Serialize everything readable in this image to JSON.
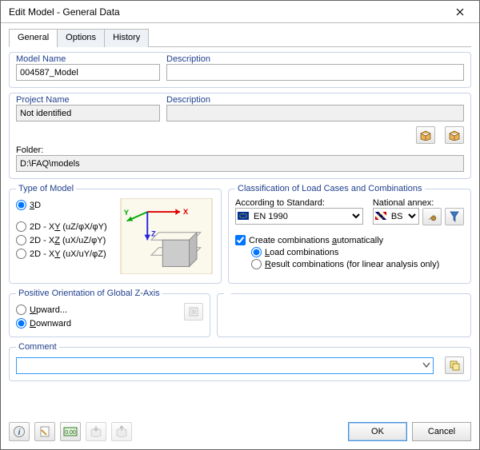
{
  "window": {
    "title": "Edit Model - General Data",
    "ok": "OK",
    "cancel": "Cancel"
  },
  "tabs": {
    "general": "General",
    "options": "Options",
    "history": "History"
  },
  "model": {
    "name_label": "Model Name",
    "name_value": "004587_Model",
    "desc_label": "Description",
    "desc_value": ""
  },
  "project": {
    "name_label": "Project Name",
    "name_value": "Not identified",
    "desc_label": "Description",
    "desc_value": "",
    "folder_label": "Folder:",
    "folder_value": "D:\\FAQ\\models"
  },
  "type": {
    "legend": "Type of Model",
    "opt3d_a": "3",
    "opt3d_b": "D",
    "xy_a": "2D - X",
    "xy_u": "Y",
    "xy_b": " (u",
    "xy_u2": "Z",
    "xy_c": "/φ",
    "xy_u3": "X",
    "xy_d": "/φ",
    "xy_u4": "Y",
    "xy_e": ")",
    "xz_a": "2D - X",
    "xz_u": "Z",
    "xz_b": " (u",
    "xz_u2": "X",
    "xz_c": "/u",
    "xz_u3": "Z",
    "xz_d": "/φ",
    "xz_u4": "Y",
    "xz_e": ")",
    "xy2_a": "2D - X",
    "xy2_u": "Y",
    "xy2_b": " (u",
    "xy2_u2": "X",
    "xy2_c": "/u",
    "xy2_u3": "Y",
    "xy2_d": "/φ",
    "xy2_u4": "Z",
    "xy2_e": ")"
  },
  "classification": {
    "legend": "Classification of Load Cases and Combinations",
    "standard_label": "According to Standard:",
    "standard_value": "EN 1990",
    "annex_label": "National annex:",
    "annex_value": "BS",
    "create_a": "Create combinations ",
    "create_u": "a",
    "create_b": "utomatically",
    "load_u": "L",
    "load_b": "oad combinations",
    "result_u": "R",
    "result_b": "esult combinations (for linear analysis only)"
  },
  "zaxis": {
    "legend": "Positive Orientation of Global Z-Axis",
    "up_u": "U",
    "up_b": "pward...",
    "down_u": "D",
    "down_b": "ownward"
  },
  "comment": {
    "legend": "Comment"
  }
}
